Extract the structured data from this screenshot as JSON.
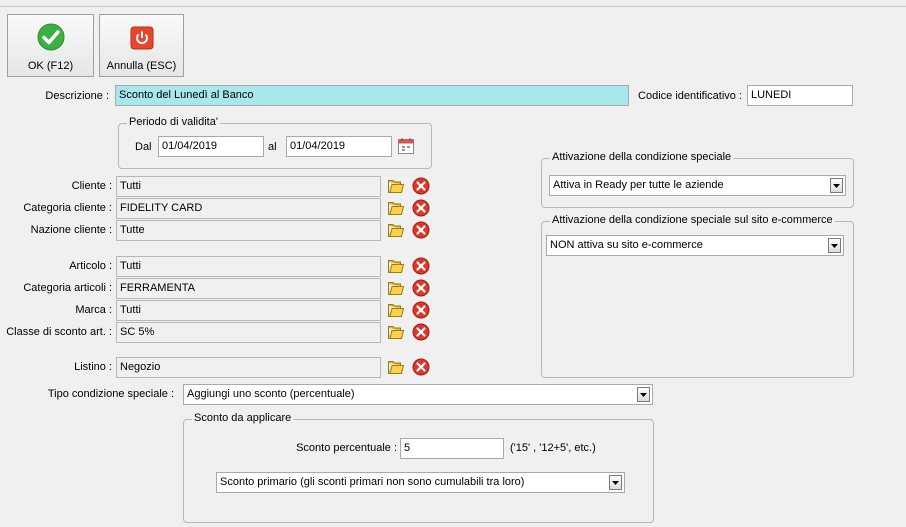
{
  "toolbar": {
    "ok_label": "OK (F12)",
    "cancel_label": "Annulla (ESC)"
  },
  "form": {
    "descrizione_label": "Descrizione :",
    "descrizione_value": "Sconto del Lunedì al Banco",
    "codice_label": "Codice identificativo :",
    "codice_value": "LUNEDI",
    "periodo": {
      "title": "Periodo di validita'",
      "dal_label": "Dal",
      "dal_value": "01/04/2019",
      "al_label": "al",
      "al_value": "01/04/2019"
    },
    "cliente_label": "Cliente :",
    "cliente_value": "Tutti",
    "categoria_cliente_label": "Categoria cliente :",
    "categoria_cliente_value": "FIDELITY CARD",
    "nazione_cliente_label": "Nazione cliente :",
    "nazione_cliente_value": "Tutte",
    "articolo_label": "Articolo :",
    "articolo_value": "Tutti",
    "categoria_articoli_label": "Categoria articoli :",
    "categoria_articoli_value": "FERRAMENTA",
    "marca_label": "Marca :",
    "marca_value": "Tutti",
    "classe_sconto_label": "Classe di sconto art. :",
    "classe_sconto_value": "SC 5%",
    "listino_label": "Listino :",
    "listino_value": "Negozio",
    "tipo_label": "Tipo condizione speciale :",
    "tipo_value": "Aggiungi uno sconto (percentuale)",
    "sconto": {
      "title": "Sconto da applicare",
      "perc_label": "Sconto percentuale :",
      "perc_value": "5",
      "hint": "('15' , '12+5', etc.)",
      "primario_value": "Sconto primario (gli sconti primari non sono cumulabili tra loro)"
    }
  },
  "attivazione": {
    "title": "Attivazione della condizione speciale",
    "value": "Attiva in Ready per tutte le aziende"
  },
  "ecommerce": {
    "title": "Attivazione della condizione speciale sul sito e-commerce",
    "value": "NON attiva su sito e-commerce"
  },
  "colors": {
    "highlight_field": "#a7e8ec",
    "ok_green": "#3cb043",
    "cancel_red": "#e8452c"
  }
}
